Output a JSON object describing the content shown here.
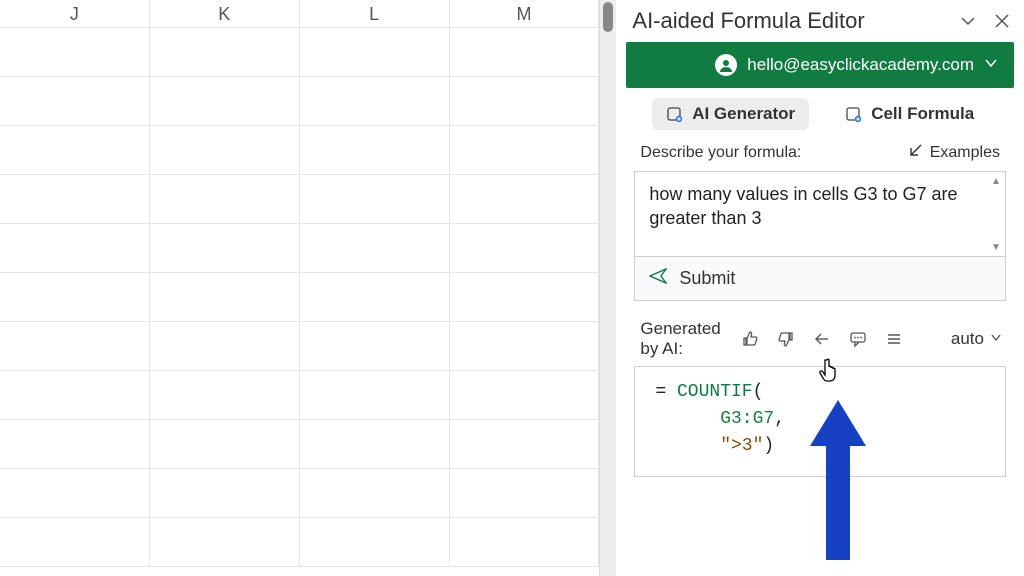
{
  "sheet": {
    "columns": [
      "J",
      "K",
      "L",
      "M"
    ],
    "row_count": 11
  },
  "panel": {
    "title": "AI-aided Formula Editor",
    "account_email": "hello@easyclickacademy.com",
    "tabs": {
      "ai_generator": "AI Generator",
      "cell_formula": "Cell Formula"
    },
    "describe_label": "Describe your formula:",
    "examples_label": "Examples",
    "describe_text": "how many values in cells G3 to G7 are greater than 3",
    "submit_label": "Submit",
    "generated_label_l1": "Generated",
    "generated_label_l2": "by AI:",
    "auto_label": "auto",
    "formula": {
      "eq": "= ",
      "fn": "COUNTIF",
      "open": "(",
      "arg1": "G3:G7",
      "comma": ",",
      "arg2": "\">3\"",
      "close": ")"
    }
  },
  "colors": {
    "brand_green": "#107c41",
    "arrow_blue": "#1741c4"
  }
}
